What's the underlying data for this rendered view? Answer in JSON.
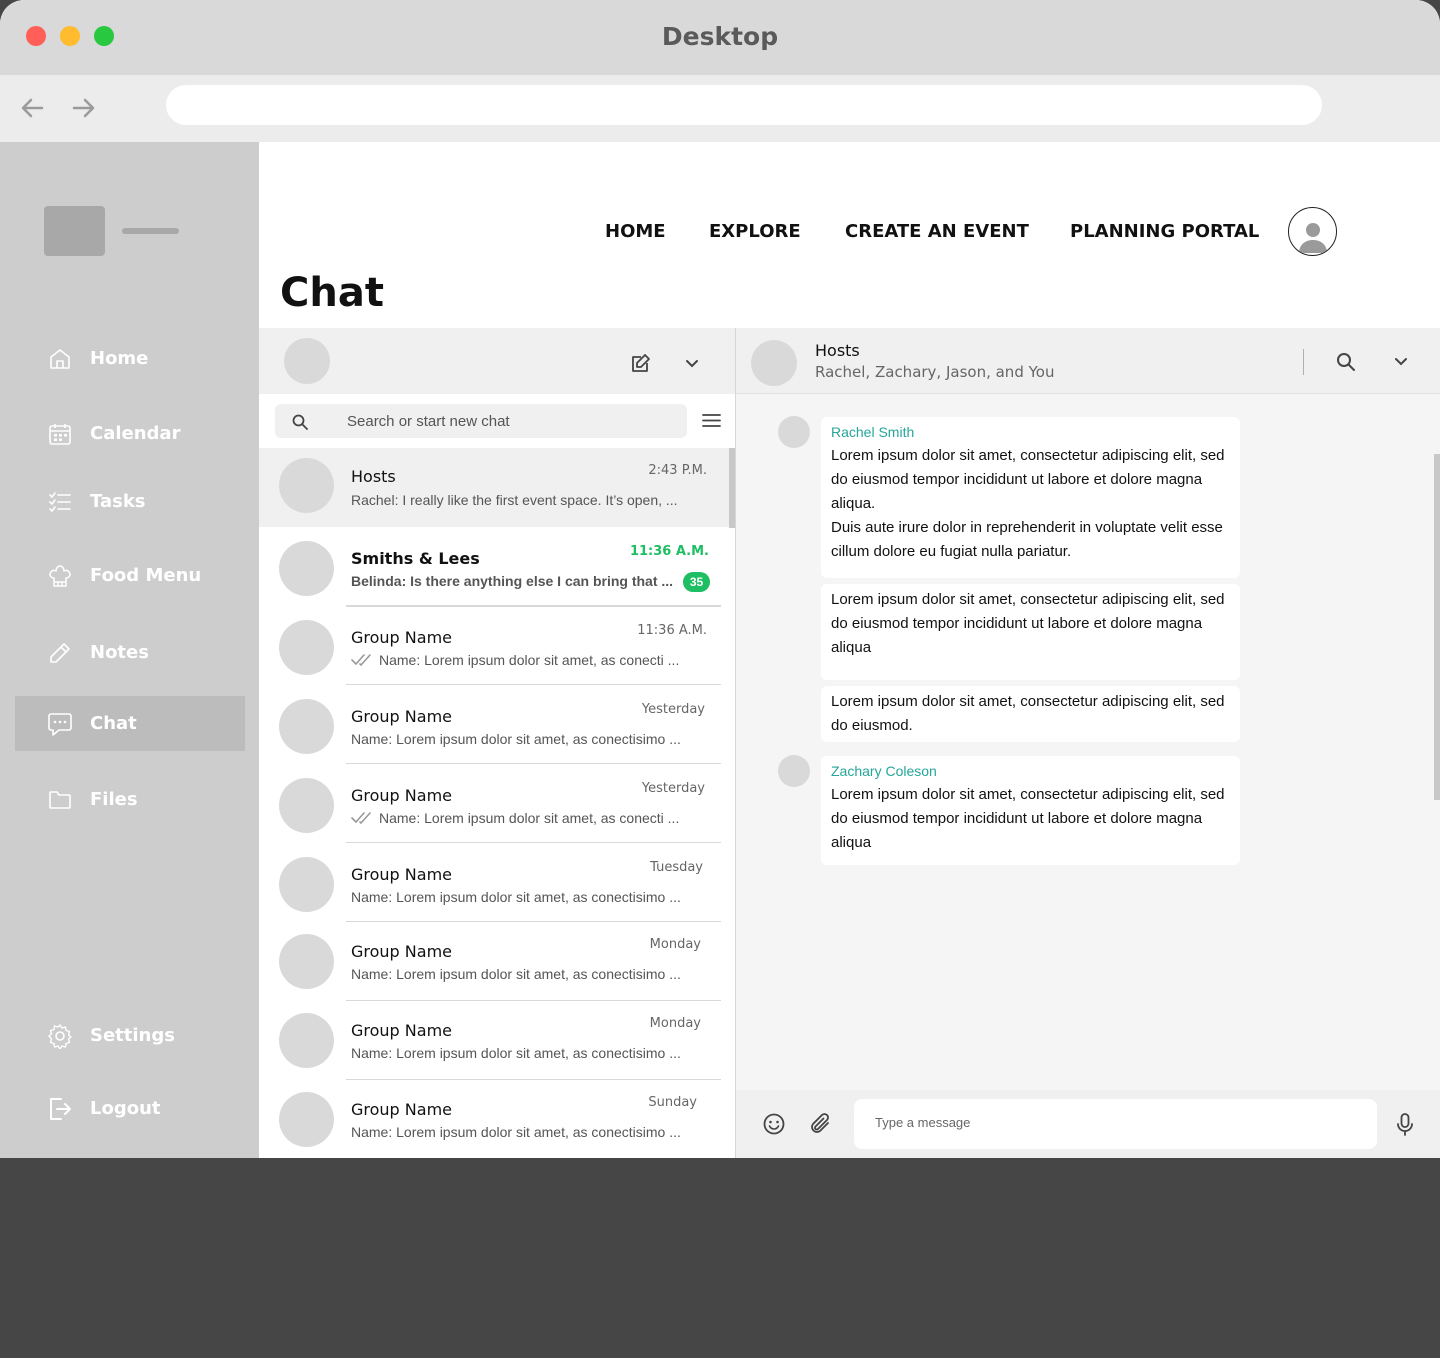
{
  "window": {
    "title": "Desktop"
  },
  "colors": {
    "close": "#ff5f57",
    "minimize": "#febc2e",
    "zoom": "#28c840",
    "accent_green": "#1ebe62",
    "sender_teal": "#26a69a"
  },
  "sidebar": {
    "items": [
      {
        "label": "Home",
        "icon": "home-icon"
      },
      {
        "label": "Calendar",
        "icon": "calendar-icon"
      },
      {
        "label": "Tasks",
        "icon": "tasks-icon"
      },
      {
        "label": "Food Menu",
        "icon": "chef-hat-icon"
      },
      {
        "label": "Notes",
        "icon": "pencil-icon"
      },
      {
        "label": "Chat",
        "icon": "chat-bubble-icon",
        "active": true
      },
      {
        "label": "Files",
        "icon": "folder-icon"
      }
    ],
    "settings": "Settings",
    "logout": "Logout"
  },
  "topnav": {
    "home": "HOME",
    "explore": "EXPLORE",
    "create": "CREATE AN EVENT",
    "portal": "PLANNING PORTAL"
  },
  "page_title": "Chat",
  "search": {
    "placeholder": "Search or start new chat"
  },
  "chats": [
    {
      "name": "Hosts",
      "time": "2:43 P.M.",
      "msg": "Rachel: I really like the first event space. It’s open, ..."
    },
    {
      "name": "Smiths & Lees",
      "time": "11:36 A.M.",
      "msg": "Belinda: Is there anything else I can bring that ...",
      "unread": "35"
    },
    {
      "name": "Group Name",
      "time": "11:36 A.M.",
      "msg": "Name: Lorem ipsum dolor sit amet, as conecti ..."
    },
    {
      "name": "Group Name",
      "time": "Yesterday",
      "msg": "Name: Lorem ipsum dolor sit amet, as conectisimo ..."
    },
    {
      "name": "Group Name",
      "time": "Yesterday",
      "msg": "Name: Lorem ipsum dolor sit amet, as conecti ..."
    },
    {
      "name": "Group Name",
      "time": "Tuesday",
      "msg": "Name: Lorem ipsum dolor sit amet, as conectisimo ..."
    },
    {
      "name": "Group Name",
      "time": "Monday",
      "msg": "Name: Lorem ipsum dolor sit amet, as conectisimo ..."
    },
    {
      "name": "Group Name",
      "time": "Monday",
      "msg": "Name: Lorem ipsum dolor sit amet, as conectisimo ..."
    },
    {
      "name": "Group Name",
      "time": "Sunday",
      "msg": "Name: Lorem ipsum dolor sit amet, as conectisimo ..."
    }
  ],
  "conversation": {
    "title": "Hosts",
    "members": "Rachel, Zachary, Jason, and You",
    "messages": [
      {
        "sender": "Rachel Smith",
        "text": "Lorem ipsum dolor sit amet, consectetur adipiscing elit, sed do eiusmod tempor incididunt ut labore et dolore magna aliqua.",
        "text2": "Duis aute irure dolor in reprehenderit in voluptate velit esse cillum dolore eu fugiat nulla pariatur."
      },
      {
        "text": "Lorem ipsum dolor sit amet, consectetur adipiscing elit, sed do eiusmod tempor incididunt ut labore et dolore magna aliqua"
      },
      {
        "text": "Lorem ipsum dolor sit amet, consectetur adipiscing elit, sed do eiusmod."
      },
      {
        "sender": "Zachary Coleson",
        "text": "Lorem ipsum dolor sit amet, consectetur adipiscing elit, sed do eiusmod tempor incididunt ut labore et dolore magna aliqua"
      }
    ]
  },
  "composer": {
    "placeholder": "Type a message"
  }
}
